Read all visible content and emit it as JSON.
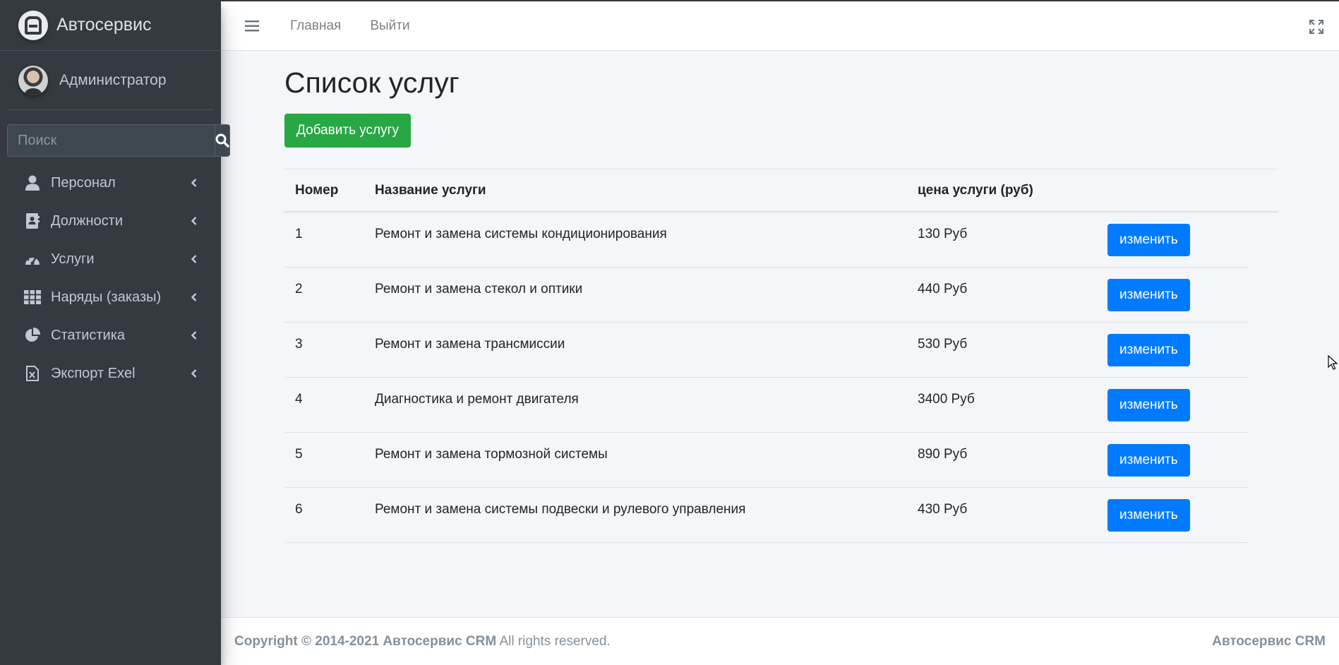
{
  "brand": {
    "name": "Автосервис"
  },
  "user": {
    "name": "Администратор"
  },
  "search": {
    "placeholder": "Поиск"
  },
  "sidebar": {
    "items": [
      {
        "label": "Персонал",
        "icon": "user-icon"
      },
      {
        "label": "Должности",
        "icon": "address-book-icon"
      },
      {
        "label": "Услуги",
        "icon": "tachometer-icon"
      },
      {
        "label": "Наряды (заказы)",
        "icon": "grid-icon"
      },
      {
        "label": "Статистика",
        "icon": "pie-chart-icon"
      },
      {
        "label": "Экспорт Exel",
        "icon": "excel-file-icon"
      }
    ]
  },
  "header": {
    "links": [
      "Главная",
      "Выйти"
    ]
  },
  "main": {
    "title": "Список услуг",
    "add_button": "Добавить услугу",
    "table": {
      "headers": [
        "Номер",
        "Название услуги",
        "цена услуги (руб)"
      ],
      "rows": [
        {
          "num": "1",
          "name": "Ремонт и замена системы кондиционирования",
          "price": "130 Руб",
          "action": "изменить"
        },
        {
          "num": "2",
          "name": "Ремонт и замена стекол и оптики",
          "price": "440 Руб",
          "action": "изменить"
        },
        {
          "num": "3",
          "name": "Ремонт и замена трансмиссии",
          "price": "530 Руб",
          "action": "изменить"
        },
        {
          "num": "4",
          "name": "Диагностика и ремонт двигателя",
          "price": "3400 Руб",
          "action": "изменить"
        },
        {
          "num": "5",
          "name": "Ремонт и замена тормозной системы",
          "price": "890 Руб",
          "action": "изменить"
        },
        {
          "num": "6",
          "name": "Ремонт и замена системы подвески и рулевого управления",
          "price": "430 Руб",
          "action": "изменить"
        }
      ]
    }
  },
  "footer": {
    "copyright_prefix": "Copyright © 2014-2021",
    "brand": "Автосервис CRM",
    "rights": "All rights reserved.",
    "right_brand": "Автосервис CRM"
  },
  "colors": {
    "sidebar": "#343a40",
    "success": "#28a745",
    "primary": "#007bff"
  }
}
